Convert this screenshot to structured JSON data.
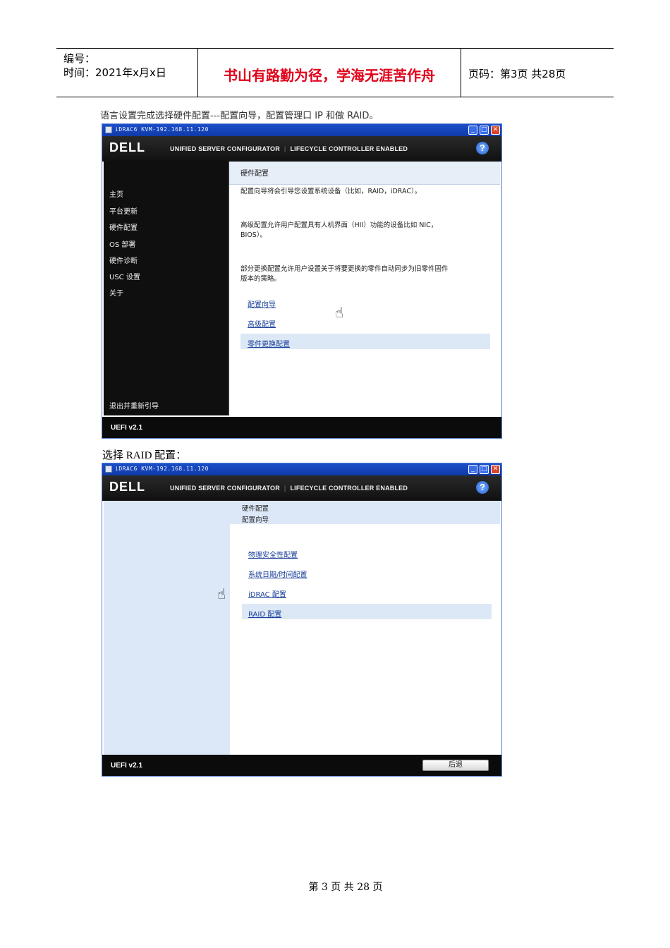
{
  "header": {
    "serial_label": "编号：",
    "time_label": "时间：2021年x月x日",
    "motto": "书山有路勤为径，学海无涯苦作舟",
    "page_label": "页码：第3页 共28页"
  },
  "caption1": "语言设置完成选择硬件配置---配置向导，配置管理口 IP 和做 RAID。",
  "caption2": "选择 RAID 配置：",
  "window_common": {
    "title": "iDRAC6 KVM-192.168.11.120",
    "logo": "DELL",
    "banner_left": "UNIFIED SERVER CONFIGURATOR",
    "banner_right": "LIFECYCLE CONTROLLER ENABLED",
    "help_icon": "?",
    "uefi_version": "UEFI v2.1"
  },
  "window1": {
    "nav": [
      "主页",
      "平台更新",
      "硬件配置",
      "OS 部署",
      "硬件诊断",
      "USC 设置",
      "关于"
    ],
    "nav_bottom": "退出并重新引导",
    "panel_title": "硬件配置",
    "paragraphs": [
      "配置向导将会引导您设置系统设备（比如，RAID，iDRAC）。",
      "高级配置允许用户配置具有人机界面（HII）功能的设备比如 NIC，BIOS）。",
      "部分更换配置允许用户设置关于将要更换的零件自动同步为旧零件固件版本的策略。"
    ],
    "links": [
      "配置向导",
      "高级配置",
      "零件更换配置"
    ]
  },
  "window2": {
    "breadcrumb_1": "硬件配置",
    "breadcrumb_2": "配置向导",
    "links": [
      "物理安全性配置",
      "系统日期/时间配置",
      "iDRAC 配置",
      "RAID 配置"
    ],
    "back_button": "后退"
  },
  "page_footer": "第 3 页 共 28 页"
}
